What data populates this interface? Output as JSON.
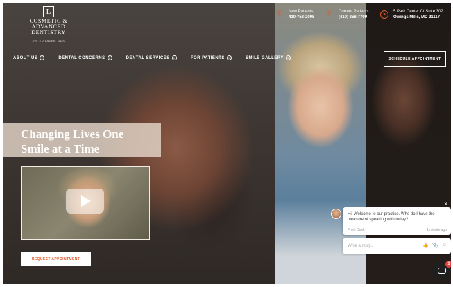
{
  "logo": {
    "mark": "L",
    "line1": "COSMETIC & ADVANCED",
    "line2": "DENTISTRY",
    "sub": "DR. ED LAZER, DDS"
  },
  "contacts": [
    {
      "icon": "phone-icon",
      "label": "New Patients",
      "value": "410-753-2005"
    },
    {
      "icon": "phone-icon",
      "label": "Current Patients",
      "value": "(410) 356-7799"
    },
    {
      "icon": "location-arrow-icon",
      "label": "5 Park Center Ct Suite 302",
      "value": "Owings Mills, MD 21117"
    }
  ],
  "nav": {
    "items": [
      {
        "label": "ABOUT US"
      },
      {
        "label": "DENTAL CONCERNS"
      },
      {
        "label": "DENTAL SERVICES"
      },
      {
        "label": "FOR PATIENTS"
      },
      {
        "label": "SMILE GALLERY"
      }
    ],
    "cta": "SCHEDULE APPOINTMENT"
  },
  "hero": {
    "headline_line1": "Changing Lives One",
    "headline_line2": "Smile at a Time",
    "request_button": "REQUEST APPOINTMENT"
  },
  "chat": {
    "close": "×",
    "message": "Hi! Welcome to our practice.  Who do I have the pleasure of speaking with today?",
    "from": "Front Desk",
    "time": "1 minute ago",
    "placeholder": "Write a reply..",
    "badge_count": "1"
  },
  "colors": {
    "accent": "#e25a2a",
    "badge": "#e0423a",
    "headline_overlay": "#e4d6c8"
  }
}
